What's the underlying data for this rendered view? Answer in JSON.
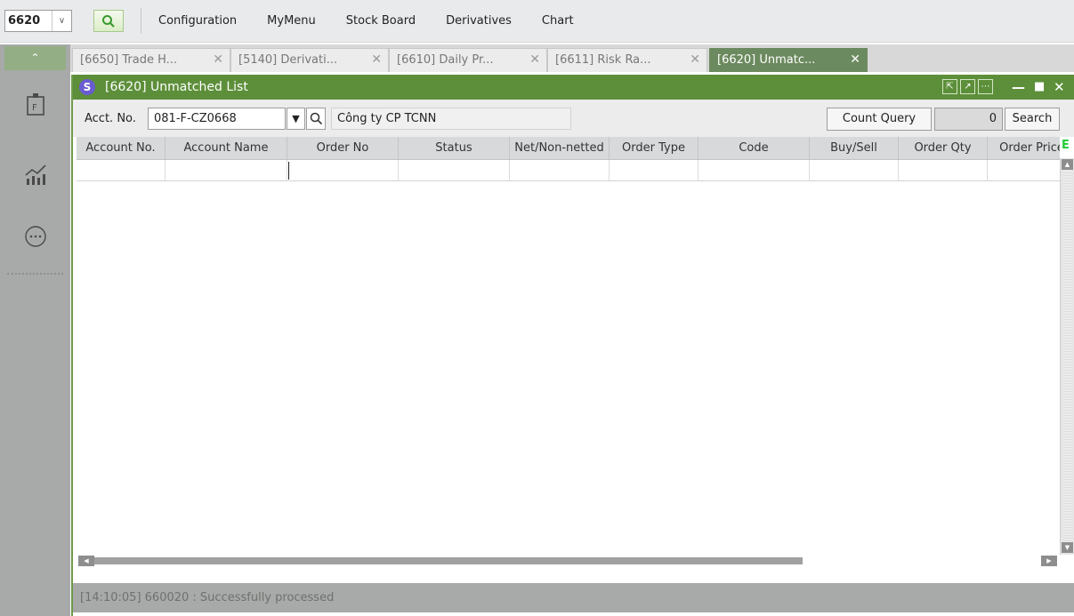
{
  "topbar": {
    "screen_code": "6620",
    "menu": [
      "Configuration",
      "MyMenu",
      "Stock Board",
      "Derivatives",
      "Chart"
    ]
  },
  "tabs": [
    {
      "label": "[6650] Trade H...",
      "active": false
    },
    {
      "label": "[5140] Derivati...",
      "active": false
    },
    {
      "label": "[6610] Daily Pr...",
      "active": false
    },
    {
      "label": "[6611] Risk Ra...",
      "active": false
    },
    {
      "label": "[6620] Unmatc...",
      "active": true
    }
  ],
  "window": {
    "title": "[6620] Unmatched List",
    "logo": "S"
  },
  "filter": {
    "acct_label": "Acct. No.",
    "acct_value": "081-F-CZ0668",
    "acct_name": "Công ty CP TCNN",
    "count_query_label": "Count Query",
    "count_value": "0",
    "search_label": "Search"
  },
  "grid": {
    "columns": [
      "Account No.",
      "Account Name",
      "Order No",
      "Status",
      "Net/Non-netted",
      "Order Type",
      "Code",
      "Buy/Sell",
      "Order Qty",
      "Order Price"
    ],
    "excel_marker": "E",
    "rows": []
  },
  "status": {
    "message": "[14:10:05] 660020 : Successfully processed"
  },
  "colors": {
    "window_title": "#5d8f3a",
    "active_tab": "#6c8a5f",
    "rail": "#a7aaa8"
  },
  "icons": [
    "search-icon",
    "futures-icon",
    "chart-icon",
    "more-icon",
    "window-icons"
  ]
}
